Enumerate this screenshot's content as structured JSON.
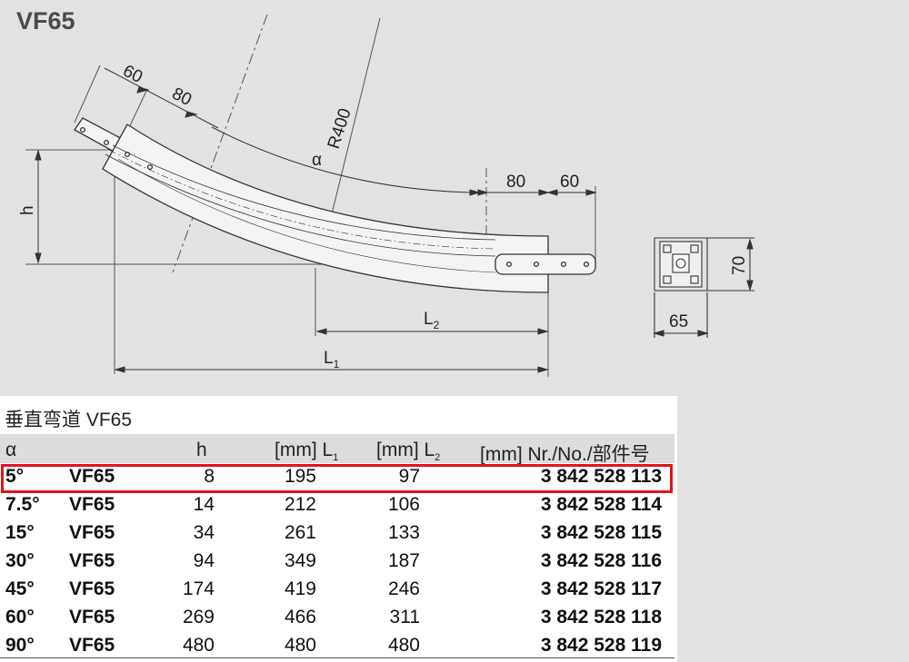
{
  "title": "VF65",
  "drawing": {
    "dims": {
      "d60_top": "60",
      "d80_top": "80",
      "radius": "R400",
      "alpha": "α",
      "h": "h",
      "d80_right": "80",
      "d60_right": "60",
      "L2": "L",
      "L2_sub": "2",
      "L1": "L",
      "L1_sub": "1",
      "d70": "70",
      "d65": "65"
    }
  },
  "caption": "垂直弯道 VF65",
  "table": {
    "headers": {
      "alpha": "α",
      "h": "h",
      "l1": "[mm] L",
      "l1_sub": "1",
      "l2": "[mm] L",
      "l2_sub": "2",
      "nr": "[mm] Nr./No./部件号"
    },
    "rows": [
      {
        "angle": "5°",
        "model": "VF65",
        "h": "8",
        "l1": "195",
        "l2": "97",
        "nr": "3 842 528 113"
      },
      {
        "angle": "7.5°",
        "model": "VF65",
        "h": "14",
        "l1": "212",
        "l2": "106",
        "nr": "3 842 528 114"
      },
      {
        "angle": "15°",
        "model": "VF65",
        "h": "34",
        "l1": "261",
        "l2": "133",
        "nr": "3 842 528 115"
      },
      {
        "angle": "30°",
        "model": "VF65",
        "h": "94",
        "l1": "349",
        "l2": "187",
        "nr": "3 842 528 116"
      },
      {
        "angle": "45°",
        "model": "VF65",
        "h": "174",
        "l1": "419",
        "l2": "246",
        "nr": "3 842 528 117"
      },
      {
        "angle": "60°",
        "model": "VF65",
        "h": "269",
        "l1": "466",
        "l2": "311",
        "nr": "3 842 528 118"
      },
      {
        "angle": "90°",
        "model": "VF65",
        "h": "480",
        "l1": "480",
        "l2": "480",
        "nr": "3 842 528 119"
      }
    ],
    "highlight_color": "#e0141b"
  }
}
